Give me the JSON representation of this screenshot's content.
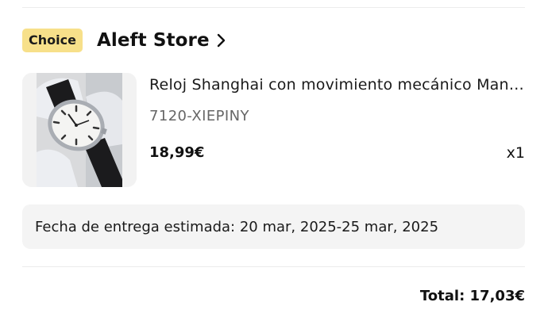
{
  "store": {
    "badge_label": "Choice",
    "name": "Aleft Store",
    "colors": {
      "badge_bg": "#f7e08a"
    },
    "chevron_icon": "chevron-right-icon"
  },
  "product": {
    "image_icon": "wristwatch-photo",
    "title": "Reloj Shanghai con movimiento mecánico Manual para hombre",
    "title_visible": "Reloj Shanghai con movimiento mecánico Man…",
    "variant": "7120-XIEPINY",
    "price": "18,99€",
    "quantity": "x1"
  },
  "delivery": {
    "text": "Fecha de entrega estimada: 20 mar, 2025-25 mar, 2025"
  },
  "summary": {
    "total": "Total: 17,03€"
  }
}
